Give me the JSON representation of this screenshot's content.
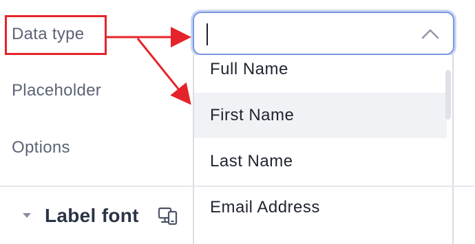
{
  "fields": {
    "data_type": "Data type",
    "placeholder": "Placeholder",
    "options": "Options"
  },
  "select": {
    "value": "",
    "state": "open"
  },
  "dropdown": {
    "options": [
      "Full Name",
      "First Name",
      "Last Name",
      "Email Address"
    ],
    "highlighted": "First Name"
  },
  "section": {
    "title": "Label font",
    "icon": "responsive-devices-icon",
    "toggle_icon": "caret-down-icon"
  },
  "annotation": {
    "color": "#e5232a"
  }
}
